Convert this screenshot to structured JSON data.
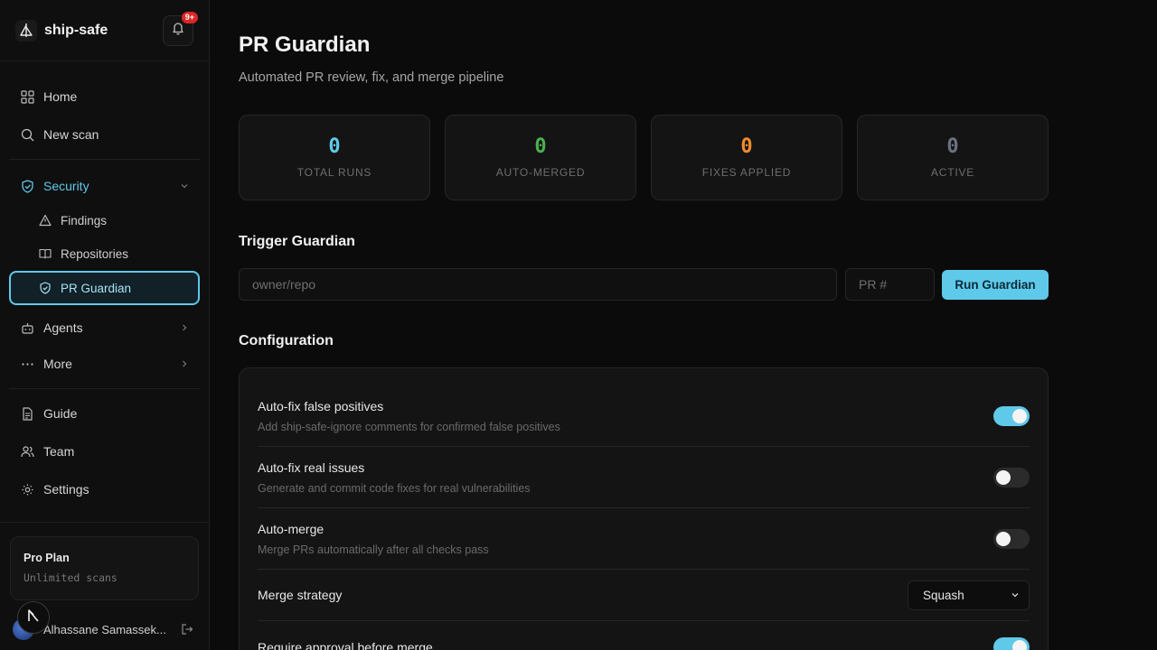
{
  "brand": {
    "name": "ship-safe",
    "notification_count": "9+"
  },
  "sidebar": {
    "items": [
      {
        "label": "Home",
        "icon": "grid-icon"
      },
      {
        "label": "New scan",
        "icon": "search-icon"
      }
    ],
    "security": {
      "label": "Security",
      "icon": "shield-icon",
      "children": [
        {
          "label": "Findings",
          "icon": "warning-triangle-icon"
        },
        {
          "label": "Repositories",
          "icon": "book-icon"
        },
        {
          "label": "PR Guardian",
          "icon": "shield-check-icon",
          "active": true
        }
      ]
    },
    "groups": [
      {
        "label": "Agents",
        "icon": "bot-icon"
      },
      {
        "label": "More",
        "icon": "ellipsis-icon"
      }
    ],
    "bottom_items": [
      {
        "label": "Guide",
        "icon": "document-icon"
      },
      {
        "label": "Team",
        "icon": "users-icon"
      },
      {
        "label": "Settings",
        "icon": "gear-icon"
      }
    ],
    "plan": {
      "title": "Pro Plan",
      "subtitle": "Unlimited scans"
    },
    "user": {
      "name": "Alhassane Samassek..."
    }
  },
  "page": {
    "title": "PR Guardian",
    "subtitle": "Automated PR review, fix, and merge pipeline"
  },
  "stats": [
    {
      "value": "0",
      "label": "TOTAL RUNS",
      "color": "#5fc9ea"
    },
    {
      "value": "0",
      "label": "AUTO-MERGED",
      "color": "#4caf50"
    },
    {
      "value": "0",
      "label": "FIXES APPLIED",
      "color": "#f08c2e"
    },
    {
      "value": "0",
      "label": "ACTIVE",
      "color": "#6b7280"
    }
  ],
  "trigger": {
    "title": "Trigger Guardian",
    "repo_placeholder": "owner/repo",
    "pr_placeholder": "PR #",
    "run_label": "Run Guardian"
  },
  "config": {
    "title": "Configuration",
    "rows": [
      {
        "label": "Auto-fix false positives",
        "desc": "Add ship-safe-ignore comments for confirmed false positives",
        "enabled": true
      },
      {
        "label": "Auto-fix real issues",
        "desc": "Generate and commit code fixes for real vulnerabilities",
        "enabled": false
      },
      {
        "label": "Auto-merge",
        "desc": "Merge PRs automatically after all checks pass",
        "enabled": false
      }
    ],
    "merge_strategy": {
      "label": "Merge strategy",
      "value": "Squash"
    },
    "require_approval": {
      "label": "Require approval before merge",
      "enabled": true
    }
  },
  "colors": {
    "accent": "#5fc9ea",
    "badge": "#dc2626"
  }
}
